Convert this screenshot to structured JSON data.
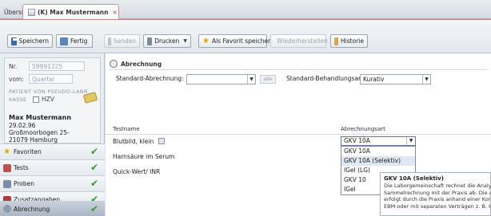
{
  "tabs": {
    "overview_label": "Übersicht",
    "active_label": "(K) Max Mustermann",
    "close_glyph": "×"
  },
  "toolbar": {
    "save": "Speichern",
    "done": "Fertig",
    "send": "Senden",
    "print": "Drucken",
    "favorite": "Als Favorit speichern",
    "restore": "Wiederherstellen",
    "history": "Historie"
  },
  "patient": {
    "nr_label": "Nr.",
    "nr_value": "59991225",
    "from_label": "vom:",
    "from_placeholder": "Quartal",
    "insurance_line1": "PATIENT VON PSEUDO-LANR",
    "insurance_line2": "KASSE",
    "hzv_label": "HZV",
    "name": "Max Mustermann",
    "dob": "29.02.96",
    "street": "Großmoorbogen 25-",
    "city": "21079 Hamburg"
  },
  "nav": {
    "items": [
      {
        "label": "Favoriten",
        "checked": true,
        "icon": "star-icon",
        "color": "#e4a400"
      },
      {
        "label": "Tests",
        "checked": true,
        "icon": "tests-icon",
        "color": "#c0504d"
      },
      {
        "label": "Proben",
        "checked": true,
        "icon": "pen-icon",
        "color": "#7a8ea8"
      },
      {
        "label": "Zusatzangaben",
        "checked": true,
        "icon": "info-icon",
        "color": "#b13b3b"
      },
      {
        "label": "Abrechnung",
        "checked": true,
        "icon": "billing-icon",
        "color": "#8e9bab",
        "active": true
      }
    ]
  },
  "billing": {
    "section_title": "Abrechnung",
    "standard_billing_label": "Standard-Abrechnung:",
    "standard_billing_value": "",
    "alle_label": "alle",
    "treatment_type_label": "Standard-Behandlungsart:",
    "treatment_type_value": "Kurativ",
    "columns": {
      "test": "Testname",
      "billing": "Abrechnungsart"
    },
    "rows": [
      {
        "name": "Blutbild, klein"
      },
      {
        "name": "Harnsäure im Serum"
      },
      {
        "name": "Quick-Wert/ INR"
      }
    ],
    "selected": "GKV 10A",
    "options": [
      "GKV 10A",
      "GKV 10A (Selektiv)",
      "IGel (LG)",
      "GKV 10",
      "IGel"
    ],
    "highlighted_index": 1
  },
  "tooltip": {
    "title": "GKV 10A (Selektiv)",
    "lines": [
      "Die Laborgemeinschaft rechnet die Analysen in e",
      "Sammelrechnung mit der Praxis ab. Die Abrechn",
      "erfolgt durch die Praxis anhand einer Komplexzi",
      "EBM oder mit separaten Verträgen z. B. HZV, IV"
    ]
  }
}
